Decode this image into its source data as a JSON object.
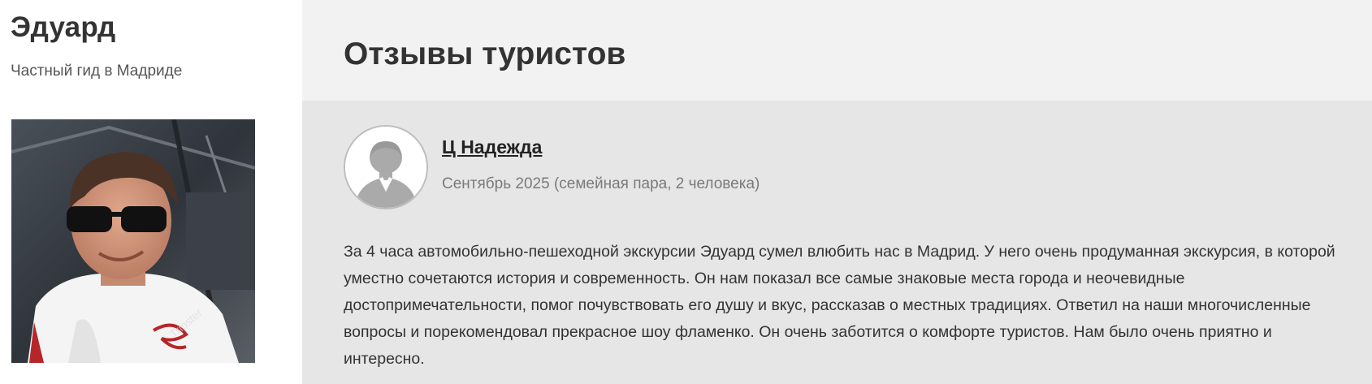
{
  "guide": {
    "name": "Эдуард",
    "subtitle": "Частный гид в Мадриде",
    "photo_watermark": "Tripster"
  },
  "reviews": {
    "title": "Отзывы туристов",
    "items": [
      {
        "author": "Ц Надежда",
        "meta": "Сентябрь 2025 (семейная пара, 2 человека)",
        "avatar_icon": "user-silhouette-icon",
        "text": "За 4 часа автомобильно-пешеходной экскурсии Эдуард сумел влюбить нас в Мадрид. У него очень продуманная экскурсия, в которой уместно сочетаются история и современность. Он нам показал все самые знаковые места города и неочевидные достопримечательности, помог почувствовать его душу и вкус, рассказав о местных традициях. Ответил на наши многочисленные вопросы и порекомендовал прекрасное шоу фламенко. Он очень заботится о комфорте туристов. Нам было очень приятно и интересно."
      }
    ]
  },
  "colors": {
    "header_bg": "#f2f2f2",
    "card_bg": "#e6e6e6",
    "text": "#333333",
    "muted": "#7a7a7a"
  }
}
